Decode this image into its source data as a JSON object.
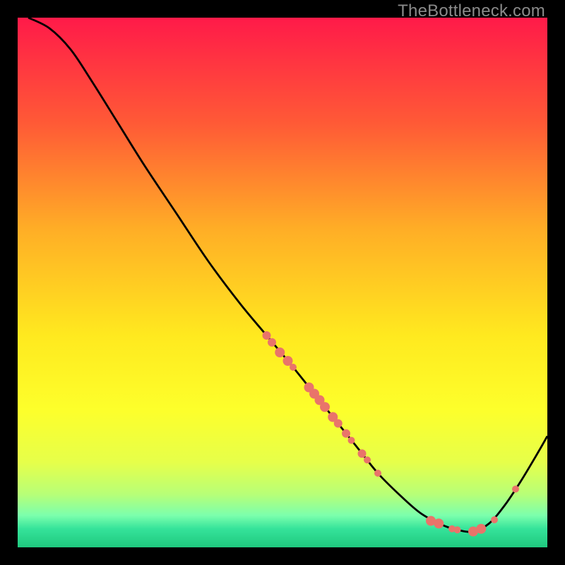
{
  "watermark": "TheBottleneck.com",
  "chart_data": {
    "type": "line",
    "title": "",
    "xlabel": "",
    "ylabel": "",
    "xlim": [
      0,
      100
    ],
    "ylim": [
      0,
      100
    ],
    "grid": false,
    "legend": false,
    "gradient_stops": [
      {
        "offset": 0.0,
        "color": "#ff1a49"
      },
      {
        "offset": 0.2,
        "color": "#ff5a36"
      },
      {
        "offset": 0.4,
        "color": "#ffae26"
      },
      {
        "offset": 0.6,
        "color": "#ffe91f"
      },
      {
        "offset": 0.74,
        "color": "#fdff2b"
      },
      {
        "offset": 0.84,
        "color": "#e6ff4a"
      },
      {
        "offset": 0.9,
        "color": "#b7ff77"
      },
      {
        "offset": 0.94,
        "color": "#7bffad"
      },
      {
        "offset": 0.965,
        "color": "#35e39a"
      },
      {
        "offset": 1.0,
        "color": "#1fc97e"
      }
    ],
    "series": [
      {
        "name": "curve",
        "color": "#000000",
        "x": [
          2,
          6,
          10,
          14,
          19,
          24,
          30,
          36,
          42,
          47,
          52,
          56,
          60,
          64,
          68,
          72,
          76,
          80,
          83,
          86,
          89,
          92,
          95,
          98,
          100
        ],
        "y": [
          100,
          98,
          94,
          88,
          80,
          72,
          63,
          54,
          46,
          40,
          34,
          29,
          24,
          19,
          14,
          10,
          6.5,
          4.3,
          3.3,
          3.0,
          4.5,
          8.0,
          12.5,
          17.5,
          21
        ]
      }
    ],
    "points": {
      "name": "markers",
      "color": "#e9746a",
      "series": [
        {
          "x": 47,
          "y": 40.0,
          "r": 6
        },
        {
          "x": 48,
          "y": 38.7,
          "r": 6
        },
        {
          "x": 49.5,
          "y": 36.8,
          "r": 7
        },
        {
          "x": 51,
          "y": 35.2,
          "r": 7
        },
        {
          "x": 52,
          "y": 34.0,
          "r": 5
        },
        {
          "x": 55,
          "y": 30.2,
          "r": 7
        },
        {
          "x": 56,
          "y": 29.0,
          "r": 7
        },
        {
          "x": 57,
          "y": 27.8,
          "r": 7
        },
        {
          "x": 58,
          "y": 26.5,
          "r": 7
        },
        {
          "x": 59.5,
          "y": 24.6,
          "r": 7
        },
        {
          "x": 60.5,
          "y": 23.4,
          "r": 6
        },
        {
          "x": 62,
          "y": 21.5,
          "r": 6
        },
        {
          "x": 63,
          "y": 20.2,
          "r": 5
        },
        {
          "x": 65,
          "y": 17.7,
          "r": 6
        },
        {
          "x": 66,
          "y": 16.5,
          "r": 5
        },
        {
          "x": 68,
          "y": 14.0,
          "r": 5
        },
        {
          "x": 78,
          "y": 5.0,
          "r": 7
        },
        {
          "x": 79.5,
          "y": 4.5,
          "r": 7
        },
        {
          "x": 82,
          "y": 3.5,
          "r": 5
        },
        {
          "x": 83,
          "y": 3.3,
          "r": 5
        },
        {
          "x": 86,
          "y": 3.0,
          "r": 7
        },
        {
          "x": 87.5,
          "y": 3.5,
          "r": 7
        },
        {
          "x": 90,
          "y": 5.2,
          "r": 5
        },
        {
          "x": 94,
          "y": 11.0,
          "r": 5
        }
      ]
    }
  }
}
